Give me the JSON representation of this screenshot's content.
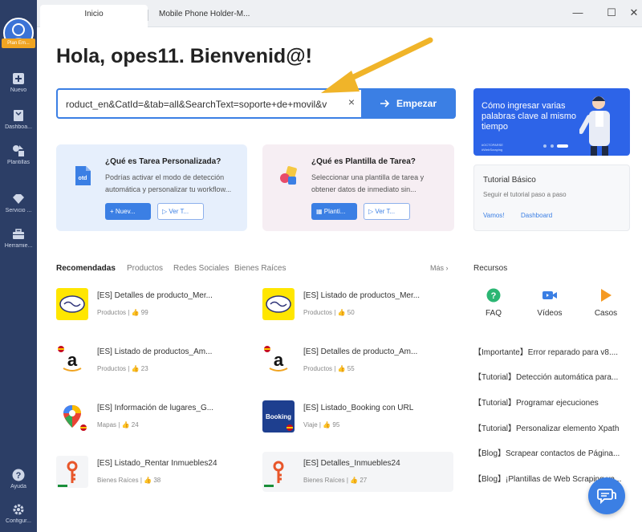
{
  "sidebar": {
    "logo_badge": "Plan Em...",
    "items": [
      {
        "label": "Nuevo",
        "icon": "plus-icon"
      },
      {
        "label": "Dashboa...",
        "icon": "bookmark-icon"
      },
      {
        "label": "Plantillas",
        "icon": "templates-icon"
      },
      {
        "label": "Servicio ...",
        "icon": "diamond-icon"
      },
      {
        "label": "Herramie...",
        "icon": "toolbox-icon"
      },
      {
        "label": "Ayuda",
        "icon": "help-icon"
      },
      {
        "label": "Configur...",
        "icon": "gear-icon"
      }
    ]
  },
  "tabs": {
    "active": "Inicio",
    "other": "Mobile Phone Holder-M..."
  },
  "window_controls": {
    "minimize": "—",
    "maximize": "☐",
    "close": "✕"
  },
  "greeting": "Hola, opes11. Bienvenid@!",
  "search": {
    "value": "roduct_en&CatId=&tab=all&SearchText=soporte+de+movil&v",
    "clear": "×",
    "button_label": "Empezar"
  },
  "cards": [
    {
      "title": "¿Qué es Tarea Personalizada?",
      "desc": "Podrías activar el modo de detección automática y personalizar tu workflow...",
      "primary": "Nuev...",
      "secondary": "Ver T..."
    },
    {
      "title": "¿Qué es Plantilla de Tarea?",
      "desc": "Seleccionar una plantilla de tarea y obtener datos de inmediato sin...",
      "primary": "Planti...",
      "secondary": "Ver T..."
    }
  ],
  "banner": {
    "text": "Cómo ingresar varias palabras clave al mismo tiempo",
    "tag_line1": "#OCTOPARSE",
    "tag_line2": "#WebScraping"
  },
  "tutorial": {
    "title": "Tutorial Básico",
    "subtitle": "Seguir el tutorial paso a paso",
    "link1": "Vamos!",
    "link2": "Dashboard"
  },
  "recommended": {
    "tabs": [
      "Recomendadas",
      "Productos",
      "Redes Sociales",
      "Bienes Raíces"
    ],
    "more": "Más"
  },
  "templates": [
    {
      "name": "[ES] Detalles de producto_Mer...",
      "category": "Productos",
      "likes": "99",
      "icon": "mercadolibre-icon"
    },
    {
      "name": "[ES] Listado de productos_Mer...",
      "category": "Productos",
      "likes": "50",
      "icon": "mercadolibre-icon"
    },
    {
      "name": "[ES] Listado de productos_Am...",
      "category": "Productos",
      "likes": "23",
      "icon": "amazon-icon"
    },
    {
      "name": "[ES] Detalles de producto_Am...",
      "category": "Productos",
      "likes": "55",
      "icon": "amazon-icon"
    },
    {
      "name": "[ES] Información de lugares_G...",
      "category": "Mapas",
      "likes": "24",
      "icon": "google-maps-icon"
    },
    {
      "name": "[ES] Listado_Booking con URL",
      "category": "Viaje",
      "likes": "95",
      "icon": "booking-icon"
    },
    {
      "name": "[ES] Listado_Rentar Inmuebles24",
      "category": "Bienes Raíces",
      "likes": "38",
      "icon": "inmuebles24-icon"
    },
    {
      "name": "[ES] Detalles_Inmuebles24",
      "category": "Bienes Raíces",
      "likes": "27",
      "icon": "inmuebles24-icon"
    }
  ],
  "resources": {
    "title": "Recursos",
    "icons": [
      {
        "label": "FAQ",
        "icon": "faq-icon"
      },
      {
        "label": "Vídeos",
        "icon": "video-icon"
      },
      {
        "label": "Casos",
        "icon": "cases-icon"
      }
    ],
    "links": [
      "【Importante】Error reparado para v8....",
      "【Tutorial】Detección automática para...",
      "【Tutorial】Programar ejecuciones",
      "【Tutorial】Personalizar elemento Xpath",
      "【Blog】Scrapear contactos de Página...",
      "【Blog】¡Plantillas de Web Scraping va..."
    ]
  },
  "colors": {
    "sidebar": "#2c3e66",
    "accent": "#3b7fe4",
    "arrow": "#f0b429"
  }
}
